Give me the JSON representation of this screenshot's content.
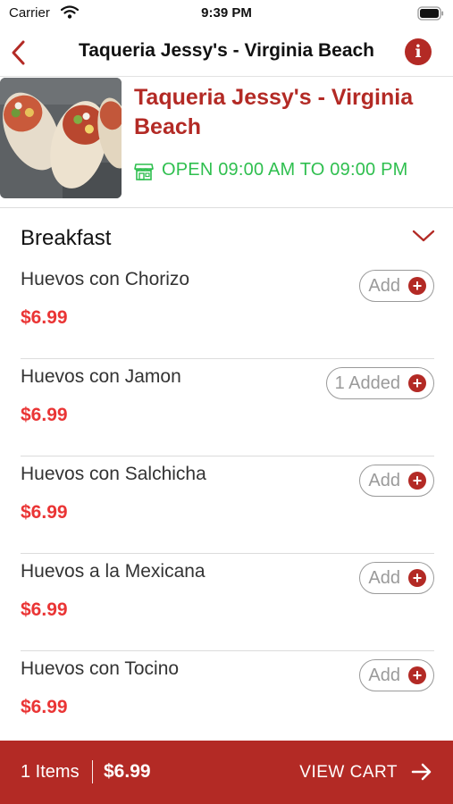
{
  "status_bar": {
    "carrier": "Carrier",
    "time": "9:39 PM",
    "icons": [
      "wifi-icon",
      "battery-icon"
    ]
  },
  "nav": {
    "back_icon": "chevron-left-icon",
    "title": "Taqueria Jessy's - Virginia Beach",
    "info_icon": "info-icon",
    "info_glyph": "i"
  },
  "restaurant": {
    "image": "burritos-photo",
    "name": "Taqueria Jessy's - Virginia Beach",
    "hours_icon": "storefront-icon",
    "hours": "OPEN 09:00 AM TO 09:00 PM"
  },
  "section": {
    "title": "Breakfast",
    "toggle_icon": "chevron-down-icon",
    "items": [
      {
        "name": "Huevos con Chorizo",
        "price": "$6.99",
        "button": "Add"
      },
      {
        "name": "Huevos con Jamon",
        "price": "$6.99",
        "button": "1 Added"
      },
      {
        "name": "Huevos con Salchicha",
        "price": "$6.99",
        "button": "Add"
      },
      {
        "name": "Huevos a la Mexicana",
        "price": "$6.99",
        "button": "Add"
      },
      {
        "name": "Huevos con Tocino",
        "price": "$6.99",
        "button": "Add"
      }
    ]
  },
  "cart": {
    "items_label": "1 Items",
    "total": "$6.99",
    "action": "VIEW CART",
    "action_icon": "arrow-right-icon"
  },
  "colors": {
    "brand": "#b32a25",
    "price": "#ea3535",
    "open_status": "#2fbf4f"
  }
}
